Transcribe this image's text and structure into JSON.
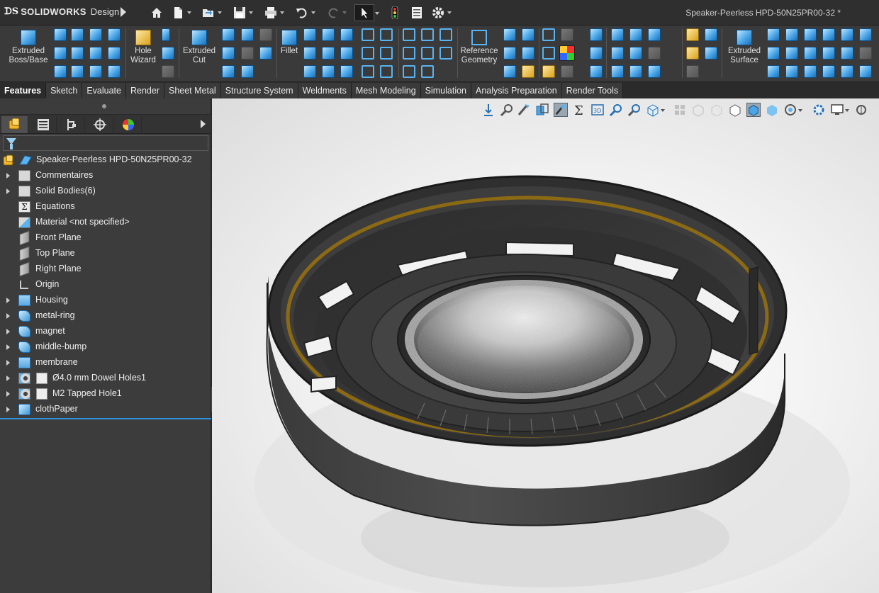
{
  "app": {
    "logo_text": "SOLIDWORKS",
    "logo_suffix": "Design",
    "document_title": "Speaker-Peerless HPD-50N25PR00-32 *"
  },
  "quick_access": [
    {
      "name": "home-icon"
    },
    {
      "name": "new-document-icon"
    },
    {
      "name": "open-icon"
    },
    {
      "name": "save-icon"
    },
    {
      "name": "print-icon"
    },
    {
      "name": "undo-icon"
    },
    {
      "name": "redo-icon"
    },
    {
      "name": "select-pointer-icon"
    },
    {
      "name": "rebuild-traffic-light-icon"
    },
    {
      "name": "file-properties-icon"
    },
    {
      "name": "options-gear-icon"
    }
  ],
  "ribbon": {
    "extruded_boss": "Extruded Boss/Base",
    "extruded_boss_l1": "Extruded",
    "extruded_boss_l2": "Boss/Base",
    "hole_wizard_l1": "Hole",
    "hole_wizard_l2": "Wizard",
    "extruded_cut_l1": "Extruded",
    "extruded_cut_l2": "Cut",
    "fillet": "Fillet",
    "reference_geometry_l1": "Reference",
    "reference_geometry_l2": "Geometry",
    "extruded_surface_l1": "Extruded",
    "extruded_surface_l2": "Surface"
  },
  "tabs": [
    {
      "label": "Features",
      "active": true
    },
    {
      "label": "Sketch"
    },
    {
      "label": "Evaluate"
    },
    {
      "label": "Render"
    },
    {
      "label": "Sheet Metal"
    },
    {
      "label": "Structure System"
    },
    {
      "label": "Weldments"
    },
    {
      "label": "Mesh Modeling"
    },
    {
      "label": "Simulation"
    },
    {
      "label": "Analysis Preparation"
    },
    {
      "label": "Render Tools"
    }
  ],
  "panel_tabs": [
    {
      "name": "feature-manager-icon"
    },
    {
      "name": "property-manager-icon"
    },
    {
      "name": "configuration-manager-icon"
    },
    {
      "name": "dimxpert-manager-icon"
    },
    {
      "name": "display-manager-icon"
    }
  ],
  "tree": {
    "root": "Speaker-Peerless HPD-50N25PR00-32",
    "items": [
      {
        "label": "Commentaires",
        "icon": "annotations-folder-icon",
        "expandable": true
      },
      {
        "label": "Solid Bodies(6)",
        "icon": "solid-bodies-folder-icon",
        "expandable": true
      },
      {
        "label": "Equations",
        "icon": "equations-icon",
        "expandable": false
      },
      {
        "label": "Material <not specified>",
        "icon": "material-icon",
        "expandable": false
      },
      {
        "label": "Front Plane",
        "icon": "plane-icon",
        "expandable": false
      },
      {
        "label": "Top Plane",
        "icon": "plane-icon",
        "expandable": false
      },
      {
        "label": "Right Plane",
        "icon": "plane-icon",
        "expandable": false
      },
      {
        "label": "Origin",
        "icon": "origin-icon",
        "expandable": false
      },
      {
        "label": "Housing",
        "icon": "folder-icon",
        "expandable": true
      },
      {
        "label": "metal-ring",
        "icon": "revolve-feature-icon",
        "expandable": true
      },
      {
        "label": "magnet",
        "icon": "revolve-feature-icon",
        "expandable": true
      },
      {
        "label": "middle-bump",
        "icon": "revolve-feature-icon",
        "expandable": true
      },
      {
        "label": "membrane",
        "icon": "folder-icon",
        "expandable": true
      },
      {
        "label": "Ø4.0 mm Dowel Holes1",
        "icon": "hole-wizard-icon",
        "expandable": true
      },
      {
        "label": "M2 Tapped Hole1",
        "icon": "hole-wizard-icon",
        "expandable": true
      },
      {
        "label": "clothPaper",
        "icon": "extrude-feature-icon",
        "expandable": true
      }
    ]
  },
  "view_toolbar": [
    {
      "name": "zoom-to-fit-icon"
    },
    {
      "name": "zoom-to-area-icon"
    },
    {
      "name": "previous-view-icon"
    },
    {
      "name": "section-view-icon"
    },
    {
      "name": "dynamic-annotation-icon"
    },
    {
      "name": "sum-icon"
    },
    {
      "name": "3d-view-icon"
    },
    {
      "name": "magnify-icon"
    },
    {
      "name": "view-orientation-icon"
    },
    {
      "name": "display-style-icon"
    },
    {
      "name": "hide-show-icon"
    },
    {
      "name": "edit-appearance-icon"
    },
    {
      "name": "apply-scene-icon"
    },
    {
      "name": "view-settings-icon"
    },
    {
      "name": "monitor-icon"
    }
  ]
}
